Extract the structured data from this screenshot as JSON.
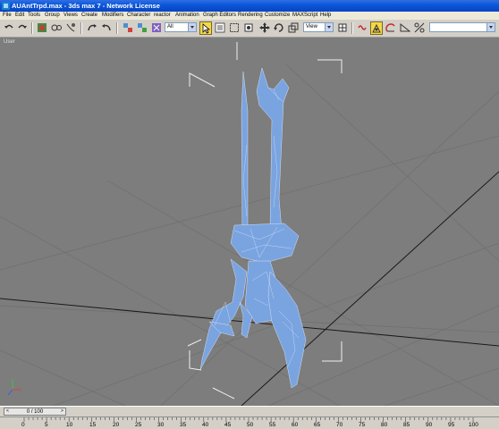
{
  "window": {
    "title": "AUAntTrpd.max - 3ds max 7 - Network License"
  },
  "menu": [
    "File",
    "Edit",
    "Tools",
    "Group",
    "Views",
    "Create",
    "Modifiers",
    "Character",
    "reactor",
    "Animation",
    "Graph Editors",
    "Rendering",
    "Customize",
    "MAXScript",
    "Help"
  ],
  "toolbar": {
    "selection_filter": "All",
    "reference_coord": "View",
    "named_selection": "",
    "icons": [
      "undo-icon",
      "redo-icon",
      "select-link-icon",
      "unlink-icon",
      "bind-spacewarp-icon",
      "selection-filter-select",
      "select-object-icon",
      "select-by-name-icon",
      "rect-region-icon",
      "window-crossing-icon",
      "move-icon",
      "rotate-icon",
      "scale-icon",
      "reference-coord-select",
      "pivot-icon",
      "mirror-icon",
      "align-icon",
      "snaps-icon",
      "angle-snap-icon",
      "percent-snap-icon",
      "spinner-snap-icon",
      "named-selection-select"
    ]
  },
  "viewport": {
    "label": "User"
  },
  "timeline": {
    "frame_display": "0 / 100",
    "prev": "<",
    "next": ">"
  },
  "trackbar": {
    "ticks": [
      "0",
      "5",
      "10",
      "15",
      "20",
      "25",
      "30",
      "35",
      "40",
      "45",
      "50",
      "55",
      "60",
      "65",
      "70",
      "75",
      "80",
      "85",
      "90",
      "95",
      "100"
    ]
  },
  "colors": {
    "title_bar": "#0a55d8",
    "viewport_bg": "#7d7d7d",
    "model": "#7aa4e0",
    "grid": "#6f6f6f",
    "selected_tool": "#f4d84a"
  }
}
